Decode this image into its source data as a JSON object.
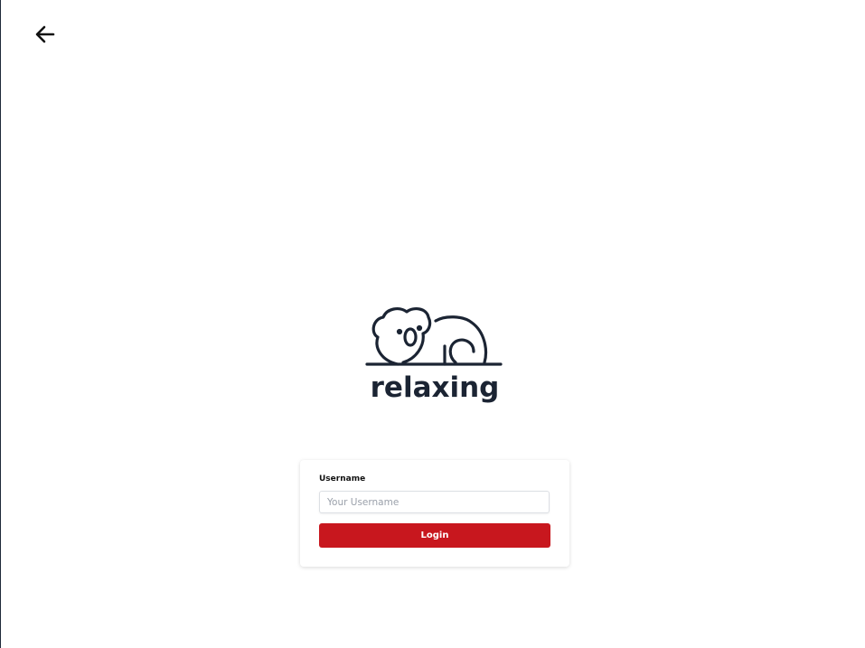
{
  "header": {
    "back_icon": "arrow-left-icon"
  },
  "logo": {
    "text": "relaxing",
    "color": "#1b2433"
  },
  "login": {
    "username_label": "Username",
    "username_placeholder": "Your Username",
    "username_value": "",
    "login_label": "Login",
    "accent": "#c8171e"
  }
}
